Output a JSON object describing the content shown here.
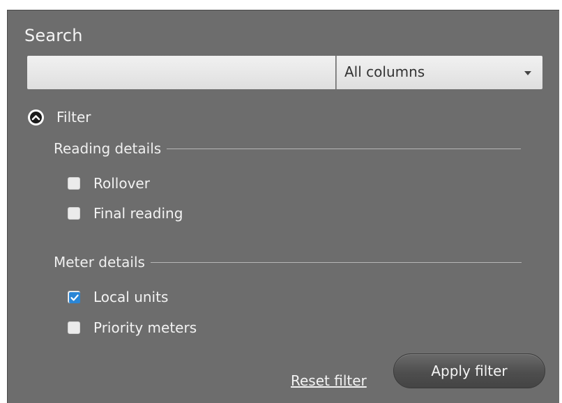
{
  "search": {
    "title": "Search",
    "input_value": "",
    "input_placeholder": "",
    "column_select": {
      "selected": "All columns"
    }
  },
  "filter": {
    "toggle_label": "Filter",
    "toggle_icon": "chevron-up-circle-icon",
    "expanded": true,
    "groups": [
      {
        "title": "Reading details",
        "options": [
          {
            "label": "Rollover",
            "checked": false
          },
          {
            "label": "Final reading",
            "checked": false
          }
        ]
      },
      {
        "title": "Meter details",
        "options": [
          {
            "label": "Local units",
            "checked": true
          },
          {
            "label": "Priority meters",
            "checked": false
          }
        ]
      }
    ]
  },
  "actions": {
    "reset_label": "Reset filter",
    "apply_label": "Apply filter"
  },
  "colors": {
    "panel_background": "#6d6d6d",
    "check_accent": "#2a86d6",
    "text": "#f2f2f2"
  }
}
